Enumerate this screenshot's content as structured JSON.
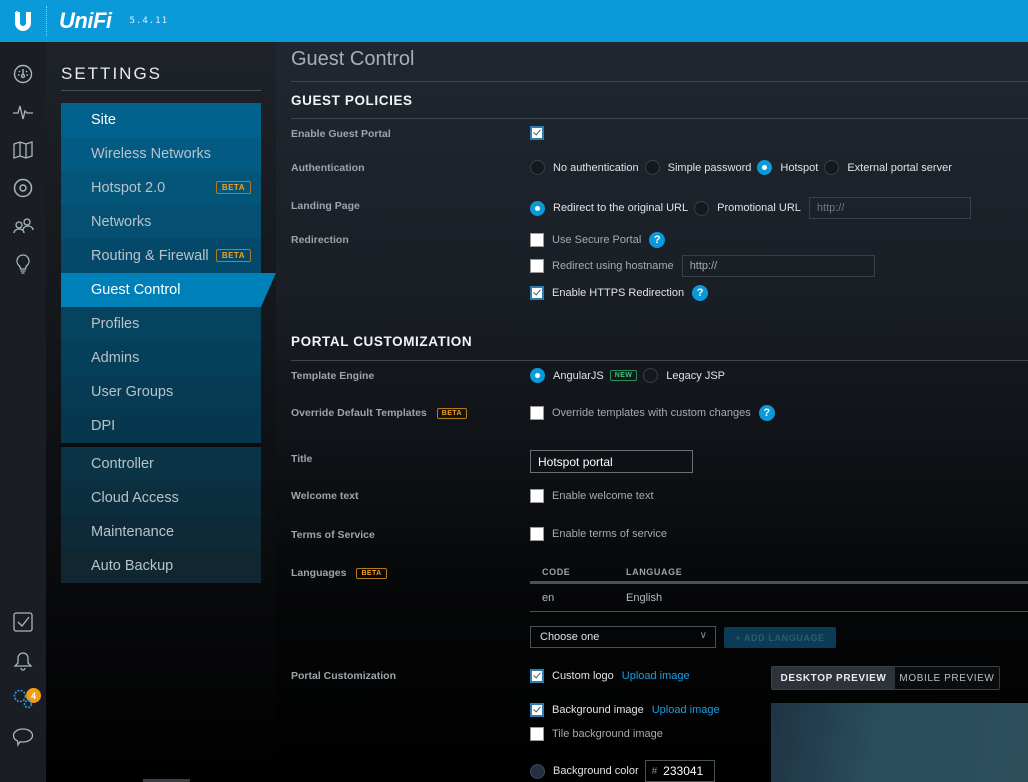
{
  "topbar": {
    "logo_icon": "ubiquiti-u-logo",
    "brand": "UniFi",
    "version": "5.4.11"
  },
  "iconbar": {
    "items": [
      {
        "name": "dashboard-icon"
      },
      {
        "name": "statistics-icon"
      },
      {
        "name": "map-icon"
      },
      {
        "name": "devices-icon"
      },
      {
        "name": "clients-icon"
      },
      {
        "name": "insights-icon"
      },
      {
        "name": "events-icon"
      },
      {
        "name": "alerts-icon",
        "badge": "4"
      },
      {
        "name": "settings-icon",
        "active": true
      },
      {
        "name": "chat-support-icon"
      }
    ]
  },
  "settings": {
    "title": "SETTINGS",
    "menu": [
      {
        "label": "Site"
      },
      {
        "label": "Wireless Networks"
      },
      {
        "label": "Hotspot 2.0",
        "badge": "BETA"
      },
      {
        "label": "Networks"
      },
      {
        "label": "Routing & Firewall",
        "badge": "BETA"
      },
      {
        "label": "Guest Control",
        "active": true
      },
      {
        "label": "Profiles"
      },
      {
        "label": "Admins"
      },
      {
        "label": "User Groups"
      },
      {
        "label": "DPI"
      }
    ],
    "menu2": [
      {
        "label": "Controller"
      },
      {
        "label": "Cloud Access"
      },
      {
        "label": "Maintenance"
      },
      {
        "label": "Auto Backup"
      }
    ]
  },
  "main": {
    "page_title": "Guest Control",
    "guest_policies": {
      "title": "GUEST POLICIES",
      "enable_guest_portal": {
        "label": "Enable Guest Portal",
        "checked": true
      },
      "authentication": {
        "label": "Authentication",
        "options": [
          "No authentication",
          "Simple password",
          "Hotspot",
          "External portal server"
        ],
        "selected": "Hotspot"
      },
      "landing_page": {
        "label": "Landing Page",
        "options": [
          "Redirect to the original URL",
          "Promotional URL"
        ],
        "selected": "Redirect to the original URL",
        "promo_placeholder": "http://"
      },
      "redirection": {
        "label": "Redirection",
        "use_secure_portal": {
          "label": "Use Secure Portal",
          "checked": false
        },
        "redirect_hostname": {
          "label": "Redirect using hostname",
          "checked": false,
          "value": "http://"
        },
        "https_redirection": {
          "label": "Enable HTTPS Redirection",
          "checked": true
        }
      }
    },
    "portal_customization": {
      "title": "PORTAL CUSTOMIZATION",
      "template_engine": {
        "label": "Template Engine",
        "options": [
          "AngularJS",
          "Legacy JSP"
        ],
        "new_tag": "NEW",
        "selected": "AngularJS"
      },
      "override_templates": {
        "label": "Override Default Templates",
        "tag": "BETA",
        "checkbox_label": "Override templates with custom changes",
        "checked": false
      },
      "title_field": {
        "label": "Title",
        "value": "Hotspot portal"
      },
      "welcome_text": {
        "label": "Welcome text",
        "checkbox_label": "Enable welcome text",
        "checked": false
      },
      "terms": {
        "label": "Terms of Service",
        "checkbox_label": "Enable terms of service",
        "checked": false
      },
      "languages": {
        "label": "Languages",
        "tag": "BETA",
        "columns": [
          "CODE",
          "LANGUAGE"
        ],
        "rows": [
          {
            "code": "en",
            "language": "English"
          }
        ],
        "select_value": "Choose one",
        "add_button": "+ ADD LANGUAGE"
      },
      "portal": {
        "label": "Portal Customization",
        "custom_logo": {
          "label": "Custom logo",
          "checked": true,
          "link": "Upload image"
        },
        "background_image": {
          "label": "Background image",
          "checked": true,
          "link": "Upload image"
        },
        "tile_background": {
          "label": "Tile background image",
          "checked": false
        },
        "background_color": {
          "label": "Background color",
          "hash": "#",
          "value": "233041",
          "color": "#233041"
        },
        "preview_tabs": [
          "DESKTOP PREVIEW",
          "MOBILE PREVIEW"
        ],
        "active_preview": "DESKTOP PREVIEW"
      }
    }
  }
}
